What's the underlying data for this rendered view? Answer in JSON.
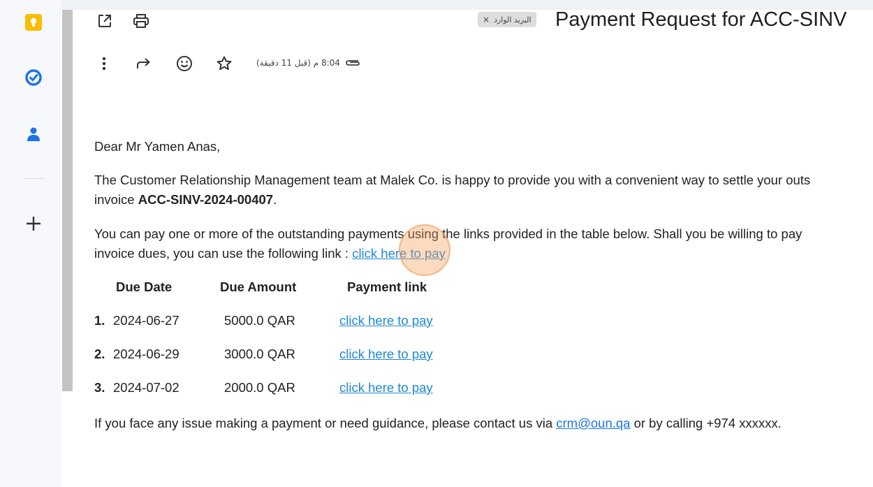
{
  "header": {
    "subject": "Payment Request for ACC-SINV",
    "inbox_chip": "البريد الوارد",
    "chip_close": "×",
    "time_info": "8:04 م (قبل 11 دقيقة)"
  },
  "email": {
    "greeting": "Dear Mr Yamen Anas,",
    "para1_line1": "The Customer Relationship Management team at Malek Co. is happy to provide you with a convenient way to settle your outs",
    "para1_line2_prefix": "invoice ",
    "invoice_number": "ACC-SINV-2024-00407",
    "para1_line2_suffix": ".",
    "para2_line1": "You can pay one or more of the outstanding payments using the links provided in the table below. Shall you be willing to pay",
    "para2_line2_prefix": "invoice dues, you can use the following link : ",
    "pay_all_link": "click here to pay",
    "table": {
      "headers": [
        "Due Date",
        "Due Amount",
        "Payment link"
      ],
      "rows": [
        {
          "num": "1.",
          "date": "2024-06-27",
          "amount": "5000.0 QAR",
          "link": "click here to pay"
        },
        {
          "num": "2.",
          "date": "2024-06-29",
          "amount": "3000.0 QAR",
          "link": "click here to pay"
        },
        {
          "num": "3.",
          "date": "2024-07-02",
          "amount": "2000.0 QAR",
          "link": "click here to pay"
        }
      ]
    },
    "contact_prefix": "If you face any issue making a payment or need guidance, please contact us via ",
    "contact_email": "crm@oun.qa",
    "contact_suffix": " or by calling +974 xxxxxx."
  },
  "icons": {
    "rail": [
      "keep-icon",
      "tasks-icon",
      "contacts-icon",
      "add-icon"
    ],
    "toolbar_top": [
      "open-in-new-icon",
      "print-icon"
    ],
    "toolbar_second": [
      "more-vert-icon",
      "forward-icon",
      "emoji-icon",
      "star-icon",
      "attachment-icon"
    ]
  },
  "colors": {
    "keep": "#fbbc04",
    "tasks": "#1a73e8",
    "contacts": "#1a73e8",
    "link": "#1a73e8",
    "cursor_highlight": "#f59e5a"
  }
}
